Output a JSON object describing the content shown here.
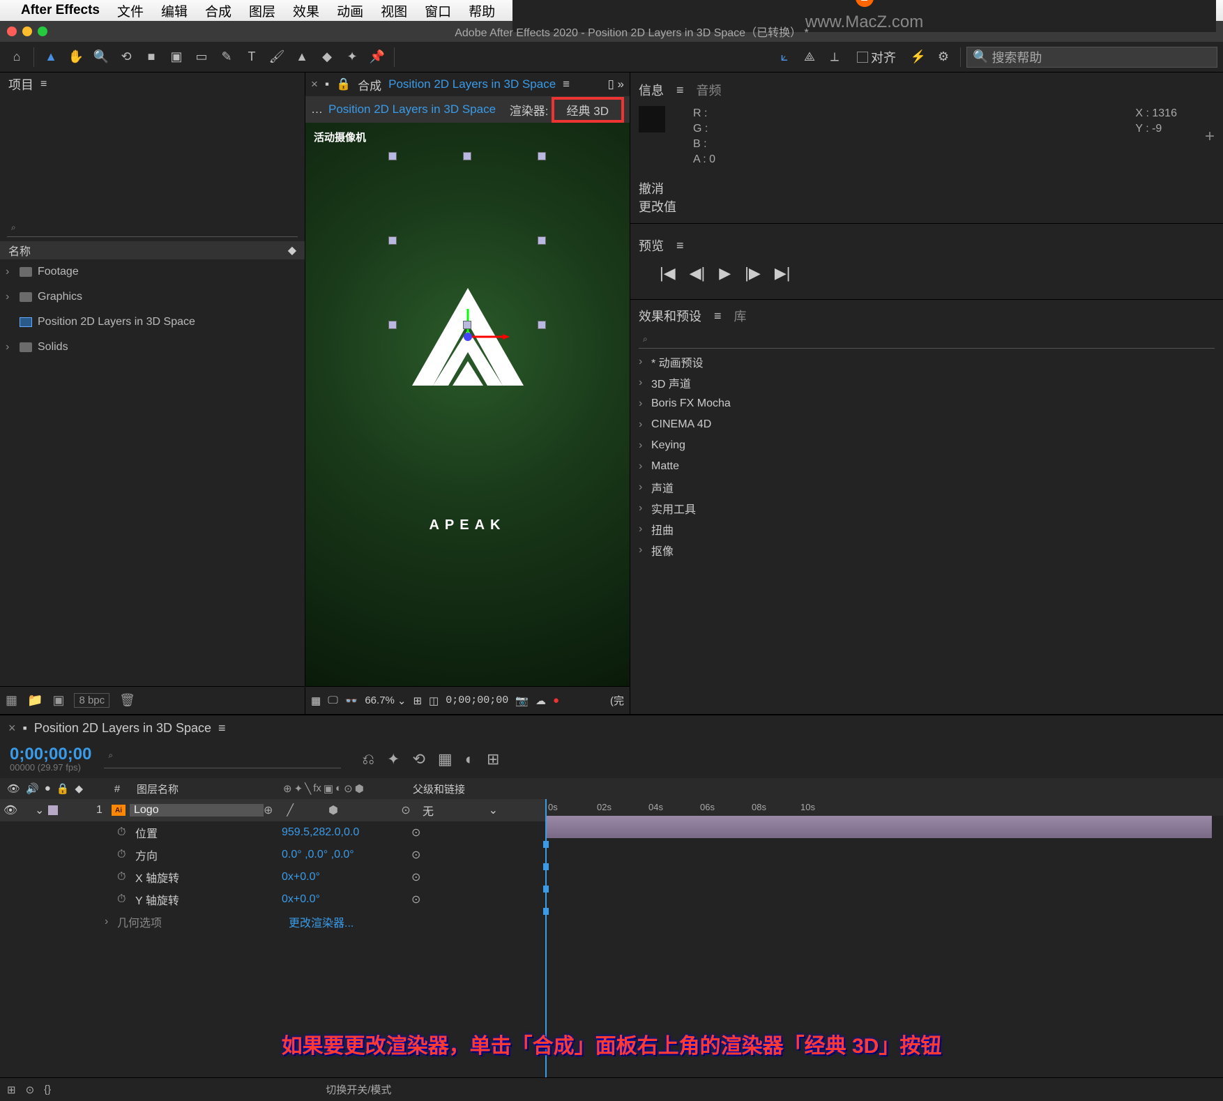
{
  "menubar": {
    "app": "After Effects",
    "items": [
      "文件",
      "编辑",
      "合成",
      "图层",
      "效果",
      "动画",
      "视图",
      "窗口",
      "帮助"
    ],
    "watermark": "www.MacZ.com"
  },
  "titlebar": {
    "title": "Adobe After Effects 2020 - Position 2D Layers in 3D Space（已转换） *"
  },
  "toolbar": {
    "align": "对齐",
    "search_placeholder": "搜索帮助"
  },
  "project": {
    "title": "项目",
    "search_placeholder": "",
    "col_name": "名称",
    "items": [
      "Footage",
      "Graphics",
      "Position 2D Layers in 3D Space",
      "Solids"
    ],
    "bpc": "8 bpc"
  },
  "composition": {
    "tab_prefix": "合成",
    "tab_name": "Position 2D Layers in 3D Space",
    "flow_name": "Position 2D Layers in 3D Space",
    "renderer_label": "渲染器:",
    "renderer_value": "经典 3D",
    "camera_label": "活动摄像机",
    "logo_text": "APEAK",
    "zoom": "66.7%",
    "timecode": "0;00;00;00",
    "footer_right": "(完"
  },
  "info": {
    "tab1": "信息",
    "tab2": "音频",
    "r": "R :",
    "g": "G :",
    "b": "B :",
    "a": "A :  0",
    "x": "X : 1316",
    "y": "Y :  -9",
    "undo": "撤消",
    "change": "更改值"
  },
  "preview": {
    "title": "预览"
  },
  "effects": {
    "title": "效果和预设",
    "tab2": "库",
    "items": [
      "* 动画预设",
      "3D 声道",
      "Boris FX Mocha",
      "CINEMA 4D",
      "Keying",
      "Matte",
      "声道",
      "实用工具",
      "扭曲",
      "抠像"
    ]
  },
  "timeline": {
    "tab": "Position 2D Layers in 3D Space",
    "timecode": "0;00;00;00",
    "fps": "00000 (29.97 fps)",
    "col_num": "#",
    "col_layer": "图层名称",
    "col_parent": "父级和链接",
    "layer1": {
      "num": "1",
      "name": "Logo",
      "parent": "无"
    },
    "props": [
      {
        "name": "位置",
        "value": "959.5,282.0,0.0"
      },
      {
        "name": "方向",
        "value": "0.0°  ,0.0°  ,0.0°"
      },
      {
        "name": "X 轴旋转",
        "value": "0x+0.0°"
      },
      {
        "name": "Y 轴旋转",
        "value": "0x+0.0°"
      }
    ],
    "geo": "几何选项",
    "geo_link": "更改渲染器...",
    "ticks": [
      "0s",
      "02s",
      "04s",
      "06s",
      "08s",
      "10s"
    ],
    "footer_switch": "切换开关/模式"
  },
  "annotation": "如果要更改渲染器，单击「合成」面板右上角的渲染器「经典 3D」按钮"
}
